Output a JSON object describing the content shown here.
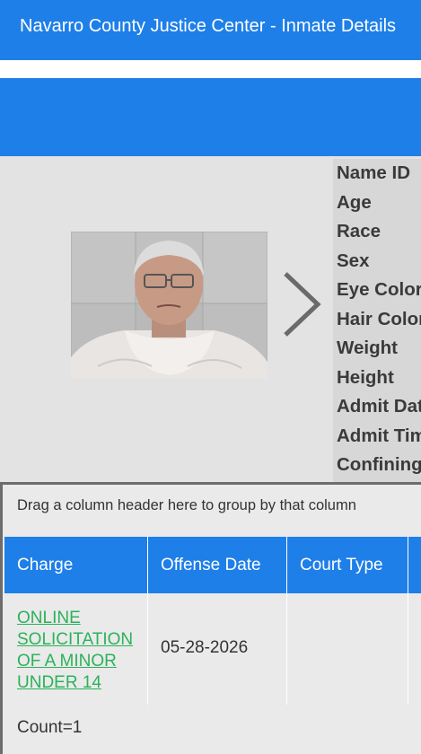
{
  "header": {
    "title": "Navarro County Justice Center - Inmate Details"
  },
  "details": {
    "labels": [
      "Name ID",
      "Age",
      "Race",
      "Sex",
      "Eye Color",
      "Hair Color",
      "Weight",
      "Height",
      "Admit Date",
      "Admit Time",
      "Confining"
    ]
  },
  "grid": {
    "group_hint": "Drag a column header here to group by that column",
    "columns": [
      "Charge",
      "Offense Date",
      "Court Type",
      ""
    ],
    "rows": [
      {
        "charge": "ONLINE SOLICITATION OF A MINOR UNDER 14",
        "offense_date": "05-28-2026",
        "court_type": ""
      }
    ],
    "count_label": "Count=1"
  },
  "colors": {
    "accent": "#1e7fe8",
    "link": "#2bb25a",
    "panel": "#e3e3e3"
  },
  "icons": {
    "next": "chevron-right-icon"
  }
}
